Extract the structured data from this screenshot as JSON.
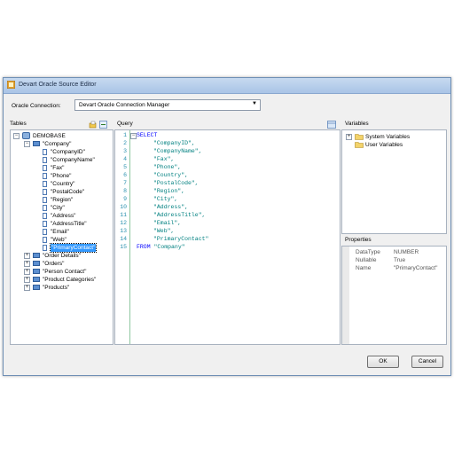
{
  "window": {
    "title": "Devart Oracle Source Editor"
  },
  "connection": {
    "label": "Oracle Connection:",
    "value": "Devart Oracle Connection Manager"
  },
  "tables": {
    "header": "Tables",
    "database": "DEMOBASE",
    "company_table": "\"Company\"",
    "columns": [
      "\"CompanyID\"",
      "\"CompanyName\"",
      "\"Fax\"",
      "\"Phone\"",
      "\"Country\"",
      "\"PostalCode\"",
      "\"Region\"",
      "\"City\"",
      "\"Address\"",
      "\"AddressTitle\"",
      "\"Email\"",
      "\"Web\"",
      "\"PrimaryContact\""
    ],
    "other_tables": [
      "\"Order Details\"",
      "\"Orders\"",
      "\"Person Contact\"",
      "\"Product Categories\"",
      "\"Products\""
    ]
  },
  "query": {
    "header": "Query",
    "lines": [
      {
        "num": "1",
        "kw": "SELECT",
        "str": ""
      },
      {
        "num": "2",
        "kw": "",
        "str": "\"CompanyID\","
      },
      {
        "num": "3",
        "kw": "",
        "str": "\"CompanyName\","
      },
      {
        "num": "4",
        "kw": "",
        "str": "\"Fax\","
      },
      {
        "num": "5",
        "kw": "",
        "str": "\"Phone\","
      },
      {
        "num": "6",
        "kw": "",
        "str": "\"Country\","
      },
      {
        "num": "7",
        "kw": "",
        "str": "\"PostalCode\","
      },
      {
        "num": "8",
        "kw": "",
        "str": "\"Region\","
      },
      {
        "num": "9",
        "kw": "",
        "str": "\"City\","
      },
      {
        "num": "10",
        "kw": "",
        "str": "\"Address\","
      },
      {
        "num": "11",
        "kw": "",
        "str": "\"AddressTitle\","
      },
      {
        "num": "12",
        "kw": "",
        "str": "\"Email\","
      },
      {
        "num": "13",
        "kw": "",
        "str": "\"Web\","
      },
      {
        "num": "14",
        "kw": "",
        "str": "\"PrimaryContact\""
      },
      {
        "num": "15",
        "kw": "FROM",
        "str": "\"Company\""
      }
    ]
  },
  "variables": {
    "header": "Variables",
    "items": [
      "System Variables",
      "User Variables"
    ]
  },
  "properties": {
    "header": "Properties",
    "rows": [
      {
        "name": "DataType",
        "value": "NUMBER"
      },
      {
        "name": "Nullable",
        "value": "True"
      },
      {
        "name": "Name",
        "value": "\"PrimaryContact\""
      }
    ]
  },
  "buttons": {
    "ok": "OK",
    "cancel": "Cancel"
  },
  "icons": {
    "app": "app-icon",
    "database": "database-icon",
    "table": "table-icon",
    "column": "column-icon",
    "folder": "folder-icon"
  }
}
